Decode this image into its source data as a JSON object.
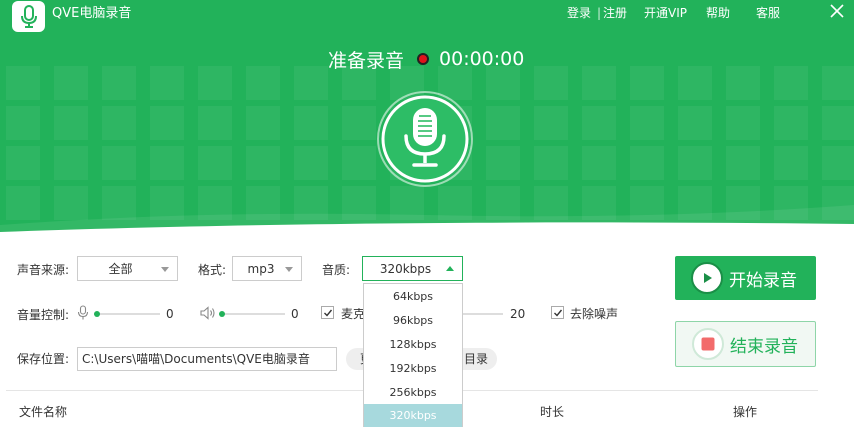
{
  "app": {
    "title": "QVE电脑录音",
    "logo_icon": "microphone-icon"
  },
  "top_links": {
    "login": "登录",
    "separator": "|",
    "register": "注册",
    "vip": "开通VIP",
    "help": "帮助",
    "service": "客服"
  },
  "status": {
    "label": "准备录音",
    "timer": "00:00:00"
  },
  "controls": {
    "source_label": "声音来源:",
    "source_value": "全部",
    "format_label": "格式:",
    "format_value": "mp3",
    "quality_label": "音质:",
    "quality_value": "320kbps",
    "volume_label": "音量控制:",
    "mic_volume_value": "0",
    "speaker_volume_value": "0",
    "mic_check_label": "麦克",
    "third_volume_value": "20",
    "denoise_label": "去除噪声",
    "save_label": "保存位置:",
    "save_path": "C:\\Users\\喵喵\\Documents\\QVE电脑录音",
    "pill_left_label": "更",
    "pill_right_label": "目录"
  },
  "buttons": {
    "start": "开始录音",
    "stop": "结束录音"
  },
  "table": {
    "col_name": "文件名称",
    "col_duration": "时长",
    "col_action": "操作"
  },
  "quality_options": [
    "64kbps",
    "96kbps",
    "128kbps",
    "192kbps",
    "256kbps",
    "320kbps"
  ],
  "colors": {
    "brand": "#22b25a",
    "record_dot": "#e0131b",
    "stop_icon": "#f26b6b",
    "selected_option": "#a7d9dd"
  }
}
